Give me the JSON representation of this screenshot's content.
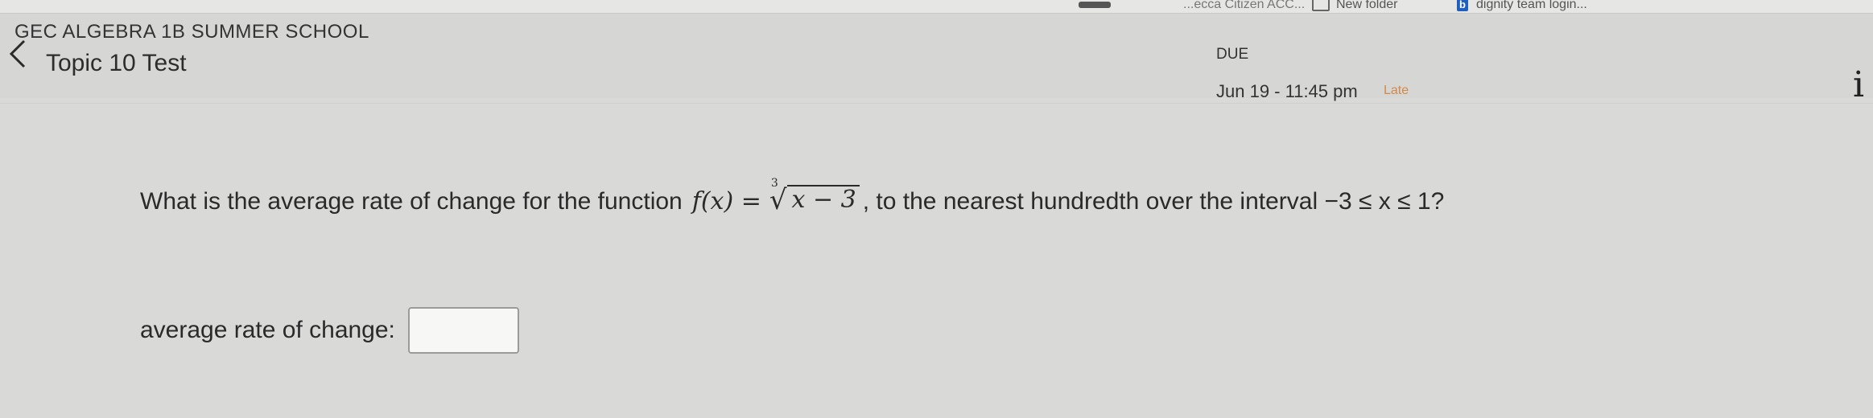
{
  "bookmarks": {
    "cut_item": "...ecca Citizen ACC...",
    "folder_label": "New folder",
    "dignity_label": "dignity team login..."
  },
  "header": {
    "course_name": "GEC ALGEBRA 1B SUMMER SCHOOL",
    "test_title": "Topic 10 Test",
    "due_label": "DUE",
    "due_date": "Jun 19 - 11:45 pm",
    "late_badge": "Late",
    "info_glyph": "i"
  },
  "question": {
    "prefix": "What is the average rate of change for the function ",
    "func": "f(x) = ",
    "root_index": "3",
    "radicand": "x − 3",
    "suffix": ", to the nearest hundredth over the interval −3 ≤ x ≤ 1?"
  },
  "answer": {
    "label": "average rate of change:",
    "value": ""
  },
  "icons": {
    "back": "chevron-left-icon",
    "info": "info-icon",
    "folder": "folder-icon",
    "bookmark": "bookmark-b-icon"
  }
}
